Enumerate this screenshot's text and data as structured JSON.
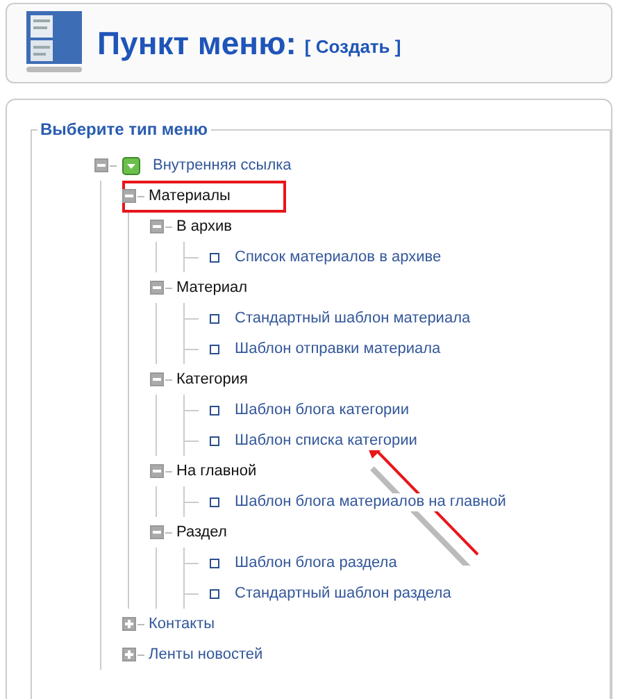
{
  "header": {
    "title": "Пункт меню:",
    "action": "[ Создать ]"
  },
  "panel": {
    "legend": "Выберите тип меню"
  },
  "tree": [
    {
      "label": "Внутренняя ссылка",
      "kind": "root",
      "expanded": true,
      "children": [
        {
          "label": "Материалы",
          "kind": "section",
          "expanded": true,
          "highlighted": true,
          "children": [
            {
              "label": "В архив",
              "kind": "section",
              "expanded": true,
              "children": [
                {
                  "label": "Список материалов в архиве",
                  "kind": "item"
                }
              ]
            },
            {
              "label": "Материал",
              "kind": "section",
              "expanded": true,
              "children": [
                {
                  "label": "Стандартный шаблон материала",
                  "kind": "item"
                },
                {
                  "label": "Шаблон отправки материала",
                  "kind": "item"
                }
              ]
            },
            {
              "label": "Категория",
              "kind": "section",
              "expanded": true,
              "children": [
                {
                  "label": "Шаблон блога категории",
                  "kind": "item"
                },
                {
                  "label": "Шаблон списка категории",
                  "kind": "item"
                }
              ]
            },
            {
              "label": "На главной",
              "kind": "section",
              "expanded": true,
              "children": [
                {
                  "label": "Шаблон блога материалов на главной",
                  "kind": "item"
                }
              ]
            },
            {
              "label": "Раздел",
              "kind": "section",
              "expanded": true,
              "children": [
                {
                  "label": "Шаблон блога раздела",
                  "kind": "item"
                },
                {
                  "label": "Стандартный шаблон раздела",
                  "kind": "item"
                }
              ]
            }
          ]
        },
        {
          "label": "Контакты",
          "kind": "link",
          "expanded": false
        },
        {
          "label": "Ленты новостей",
          "kind": "link",
          "expanded": false
        }
      ]
    }
  ]
}
